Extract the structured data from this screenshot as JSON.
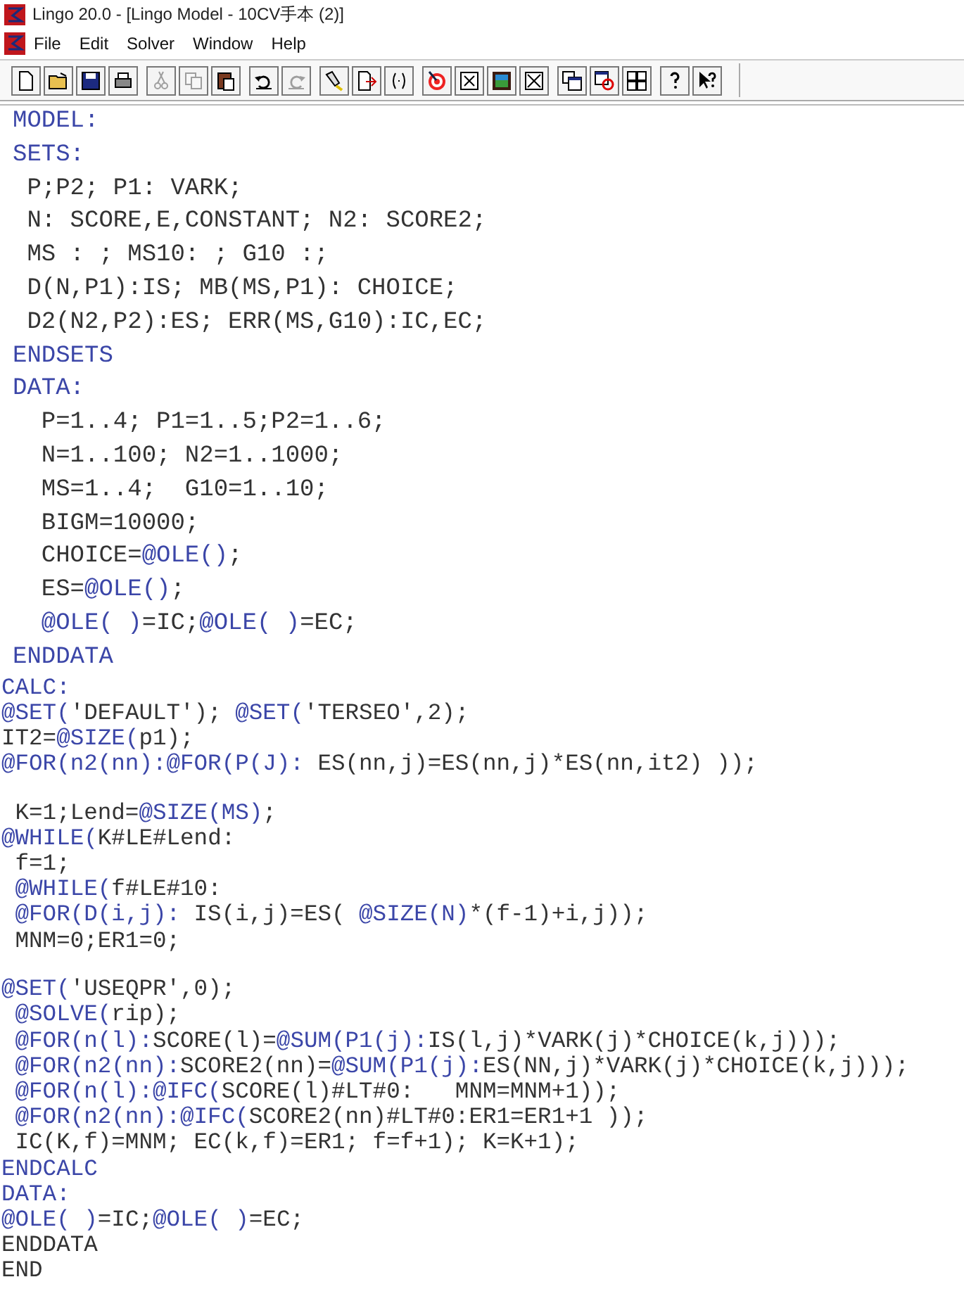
{
  "window": {
    "title": "Lingo 20.0 - [Lingo Model - 10CV手本 (2)]"
  },
  "menu": [
    "File",
    "Edit",
    "Solver",
    "Window",
    "Help"
  ],
  "toolbar": [
    [
      {
        "disabled": false
      },
      {
        "disabled": false
      },
      {
        "disabled": false
      },
      {
        "disabled": false
      }
    ],
    [
      {
        "disabled": true
      },
      {
        "disabled": true
      },
      {
        "disabled": false
      }
    ],
    [
      {
        "disabled": false
      },
      {
        "disabled": true
      }
    ],
    [
      {
        "disabled": false
      },
      {
        "disabled": false
      },
      {
        "disabled": false
      }
    ],
    [
      {
        "disabled": false
      },
      {
        "disabled": false
      },
      {
        "disabled": false
      },
      {
        "disabled": false
      }
    ],
    [
      {
        "disabled": false
      },
      {
        "disabled": false
      },
      {
        "disabled": false
      }
    ],
    [
      {
        "disabled": false
      },
      {
        "disabled": false
      }
    ]
  ],
  "editor": {
    "blocks": [
      {
        "kind": "large",
        "lines": [
          {
            "parts": [
              {
                "kind": "kw",
                "text": "MODEL:"
              }
            ]
          },
          {
            "parts": [
              {
                "kind": "kw",
                "text": "SETS:"
              }
            ]
          },
          {
            "parts": [
              {
                "kind": "plain",
                "text": " P;P2; P1: VARK;"
              }
            ]
          },
          {
            "parts": [
              {
                "kind": "plain",
                "text": " N: SCORE,E,CONSTANT; N2: SCORE2;"
              }
            ]
          },
          {
            "parts": [
              {
                "kind": "plain",
                "text": " MS : ; MS10: ; G10 :;"
              }
            ]
          },
          {
            "parts": [
              {
                "kind": "plain",
                "text": " D(N,P1):IS; MB(MS,P1): CHOICE;"
              }
            ]
          },
          {
            "parts": [
              {
                "kind": "plain",
                "text": " D2(N2,P2):ES; ERR(MS,G10):IC,EC;"
              }
            ]
          },
          {
            "parts": [
              {
                "kind": "kw",
                "text": "ENDSETS"
              }
            ]
          },
          {
            "parts": [
              {
                "kind": "kw",
                "text": "DATA:"
              }
            ]
          },
          {
            "parts": [
              {
                "kind": "plain",
                "text": "  P=1..4; P1=1..5;P2=1..6;"
              }
            ]
          },
          {
            "parts": [
              {
                "kind": "plain",
                "text": "  N=1..100; N2=1..1000;"
              }
            ]
          },
          {
            "parts": [
              {
                "kind": "plain",
                "text": "  MS=1..4;  G10=1..10;"
              }
            ]
          },
          {
            "parts": [
              {
                "kind": "plain",
                "text": "  BIGM=10000;"
              }
            ]
          },
          {
            "parts": [
              {
                "kind": "plain",
                "text": "  CHOICE="
              },
              {
                "kind": "kw",
                "text": "@OLE()"
              },
              {
                "kind": "plain",
                "text": ";"
              }
            ]
          },
          {
            "parts": [
              {
                "kind": "plain",
                "text": "  ES="
              },
              {
                "kind": "kw",
                "text": "@OLE()"
              },
              {
                "kind": "plain",
                "text": ";"
              }
            ]
          },
          {
            "parts": [
              {
                "kind": "kw",
                "text": "  @OLE( )"
              },
              {
                "kind": "plain",
                "text": "=IC;"
              },
              {
                "kind": "kw",
                "text": "@OLE( )"
              },
              {
                "kind": "plain",
                "text": "=EC;"
              }
            ]
          },
          {
            "parts": [
              {
                "kind": "kw",
                "text": "ENDDATA"
              }
            ]
          }
        ]
      },
      {
        "kind": "small",
        "lines": [
          {
            "parts": [
              {
                "kind": "kw",
                "text": "CALC:"
              }
            ]
          },
          {
            "parts": [
              {
                "kind": "kw",
                "text": "@SET("
              },
              {
                "kind": "plain",
                "text": "'DEFAULT'); "
              },
              {
                "kind": "kw",
                "text": "@SET("
              },
              {
                "kind": "plain",
                "text": "'TERSEO',2);"
              }
            ]
          },
          {
            "parts": [
              {
                "kind": "plain",
                "text": "IT2="
              },
              {
                "kind": "kw",
                "text": "@SIZE("
              },
              {
                "kind": "plain",
                "text": "p1);"
              }
            ]
          },
          {
            "parts": [
              {
                "kind": "kw",
                "text": "@FOR(n2(nn):@FOR(P(J):"
              },
              {
                "kind": "plain",
                "text": " ES(nn,j)=ES(nn,j)*ES(nn,it2) ));"
              }
            ]
          },
          {
            "kind": "blank"
          },
          {
            "parts": [
              {
                "kind": "plain",
                "text": " K=1;Lend="
              },
              {
                "kind": "kw",
                "text": "@SIZE(MS)"
              },
              {
                "kind": "plain",
                "text": ";"
              }
            ]
          },
          {
            "parts": [
              {
                "kind": "kw",
                "text": "@WHILE("
              },
              {
                "kind": "plain",
                "text": "K#LE#Lend:"
              }
            ]
          },
          {
            "parts": [
              {
                "kind": "plain",
                "text": " f=1;"
              }
            ]
          },
          {
            "parts": [
              {
                "kind": "kw",
                "text": " @WHILE("
              },
              {
                "kind": "plain",
                "text": "f#LE#10:"
              }
            ]
          },
          {
            "parts": [
              {
                "kind": "kw",
                "text": " @FOR(D(i,j):"
              },
              {
                "kind": "plain",
                "text": " IS(i,j)=ES( "
              },
              {
                "kind": "kw",
                "text": "@SIZE(N)"
              },
              {
                "kind": "plain",
                "text": "*(f-1)+i,j));"
              }
            ]
          },
          {
            "parts": [
              {
                "kind": "plain",
                "text": " MNM=0;ER1=0;"
              }
            ]
          },
          {
            "kind": "blank"
          },
          {
            "parts": [
              {
                "kind": "kw",
                "text": "@SET("
              },
              {
                "kind": "plain",
                "text": "'USEQPR',0);"
              }
            ]
          },
          {
            "parts": [
              {
                "kind": "kw",
                "text": " @SOLVE("
              },
              {
                "kind": "plain",
                "text": "rip);"
              }
            ]
          },
          {
            "parts": [
              {
                "kind": "kw",
                "text": " @FOR(n(l):"
              },
              {
                "kind": "plain",
                "text": "SCORE(l)="
              },
              {
                "kind": "kw",
                "text": "@SUM(P1(j):"
              },
              {
                "kind": "plain",
                "text": "IS(l,j)*VARK(j)*CHOICE(k,j)));"
              }
            ]
          },
          {
            "parts": [
              {
                "kind": "kw",
                "text": " @FOR(n2(nn):"
              },
              {
                "kind": "plain",
                "text": "SCORE2(nn)="
              },
              {
                "kind": "kw",
                "text": "@SUM(P1(j):"
              },
              {
                "kind": "plain",
                "text": "ES(NN,j)*VARK(j)*CHOICE(k,j)));"
              }
            ]
          },
          {
            "parts": [
              {
                "kind": "kw",
                "text": " @FOR(n(l):@IFC("
              },
              {
                "kind": "plain",
                "text": "SCORE(l)#LT#0:   MNM=MNM+1));"
              }
            ]
          },
          {
            "parts": [
              {
                "kind": "kw",
                "text": " @FOR(n2(nn):@IFC("
              },
              {
                "kind": "plain",
                "text": "SCORE2(nn)#LT#0:ER1=ER1+1 ));"
              }
            ]
          },
          {
            "parts": [
              {
                "kind": "plain",
                "text": " IC(K,f)=MNM; EC(k,f)=ER1; f=f+1); K=K+1);"
              }
            ]
          },
          {
            "parts": [
              {
                "kind": "kw",
                "text": "ENDCALC"
              }
            ]
          },
          {
            "parts": [
              {
                "kind": "kw",
                "text": "DATA:"
              }
            ]
          },
          {
            "parts": [
              {
                "kind": "kw",
                "text": "@OLE( )"
              },
              {
                "kind": "plain",
                "text": "=IC;"
              },
              {
                "kind": "kw",
                "text": "@OLE( )"
              },
              {
                "kind": "plain",
                "text": "=EC;"
              }
            ]
          },
          {
            "parts": [
              {
                "kind": "plain",
                "text": "ENDDATA"
              }
            ]
          },
          {
            "parts": [
              {
                "kind": "plain",
                "text": "END"
              }
            ]
          }
        ]
      }
    ]
  }
}
